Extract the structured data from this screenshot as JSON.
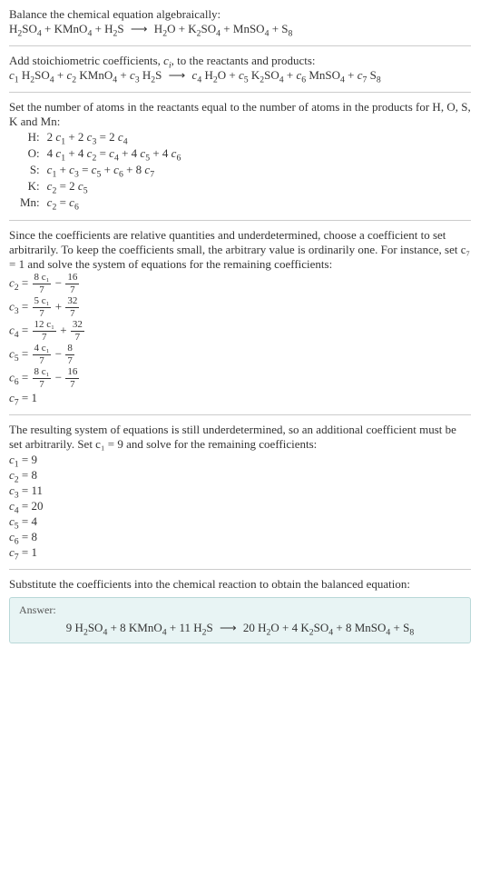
{
  "intro": {
    "line1": "Balance the chemical equation algebraically:",
    "eq": "H₂SO₄ + KMnO₄ + H₂S ⟶ H₂O + K₂SO₄ + MnSO₄ + S₈"
  },
  "stoich": {
    "line1": "Add stoichiometric coefficients, cᵢ, to the reactants and products:",
    "eq": "c₁ H₂SO₄ + c₂ KMnO₄ + c₃ H₂S ⟶ c₄ H₂O + c₅ K₂SO₄ + c₆ MnSO₄ + c₇ S₈"
  },
  "atoms": {
    "intro": "Set the number of atoms in the reactants equal to the number of atoms in the products for H, O, S, K and Mn:",
    "rows": [
      {
        "el": "H:",
        "eq": "2 c₁ + 2 c₃ = 2 c₄"
      },
      {
        "el": "O:",
        "eq": "4 c₁ + 4 c₂ = c₄ + 4 c₅ + 4 c₆"
      },
      {
        "el": "S:",
        "eq": "c₁ + c₃ = c₅ + c₆ + 8 c₇"
      },
      {
        "el": "K:",
        "eq": "c₂ = 2 c₅"
      },
      {
        "el": "Mn:",
        "eq": "c₂ = c₆"
      }
    ]
  },
  "underdet1": {
    "para": "Since the coefficients are relative quantities and underdetermined, choose a coefficient to set arbitrarily. To keep the coefficients small, the arbitrary value is ordinarily one. For instance, set c₇ = 1 and solve the system of equations for the remaining coefficients:",
    "c2": {
      "lhs": "c₂ = ",
      "num": "8 c₁",
      "den": "7",
      "mid": " − ",
      "num2": "16",
      "den2": "7"
    },
    "c3": {
      "lhs": "c₃ = ",
      "num": "5 c₁",
      "den": "7",
      "mid": " + ",
      "num2": "32",
      "den2": "7"
    },
    "c4": {
      "lhs": "c₄ = ",
      "num": "12 c₁",
      "den": "7",
      "mid": " + ",
      "num2": "32",
      "den2": "7"
    },
    "c5": {
      "lhs": "c₅ = ",
      "num": "4 c₁",
      "den": "7",
      "mid": " − ",
      "num2": "8",
      "den2": "7"
    },
    "c6": {
      "lhs": "c₆ = ",
      "num": "8 c₁",
      "den": "7",
      "mid": " − ",
      "num2": "16",
      "den2": "7"
    },
    "c7": "c₇ = 1"
  },
  "underdet2": {
    "para": "The resulting system of equations is still underdetermined, so an additional coefficient must be set arbitrarily. Set c₁ = 9 and solve for the remaining coefficients:",
    "lines": [
      "c₁ = 9",
      "c₂ = 8",
      "c₃ = 11",
      "c₄ = 20",
      "c₅ = 4",
      "c₆ = 8",
      "c₇ = 1"
    ]
  },
  "final": {
    "para": "Substitute the coefficients into the chemical reaction to obtain the balanced equation:",
    "answer_label": "Answer:",
    "answer_eq": "9 H₂SO₄ + 8 KMnO₄ + 11 H₂S ⟶ 20 H₂O + 4 K₂SO₄ + 8 MnSO₄ + S₈"
  },
  "chart_data": {
    "type": "table",
    "title": "Balanced chemical equation coefficients",
    "species": [
      "H2SO4",
      "KMnO4",
      "H2S",
      "H2O",
      "K2SO4",
      "MnSO4",
      "S8"
    ],
    "side": [
      "reactant",
      "reactant",
      "reactant",
      "product",
      "product",
      "product",
      "product"
    ],
    "coefficients": [
      9,
      8,
      11,
      20,
      4,
      8,
      1
    ],
    "atom_balance": {
      "H": "2c1 + 2c3 = 2c4",
      "O": "4c1 + 4c2 = c4 + 4c5 + 4c6",
      "S": "c1 + c3 = c5 + c6 + 8c7",
      "K": "c2 = 2c5",
      "Mn": "c2 = c6"
    }
  }
}
